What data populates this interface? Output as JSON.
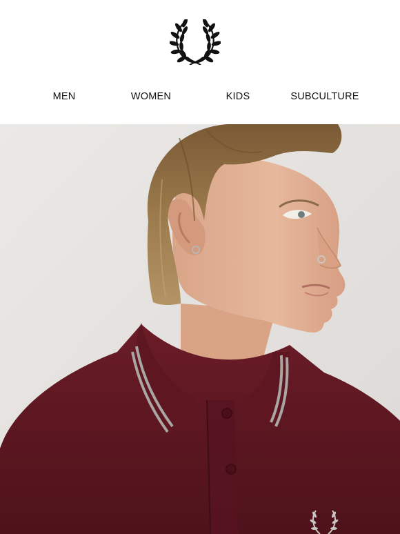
{
  "brand": {
    "logo_icon": "laurel-wreath-icon",
    "logo_color": "#111111"
  },
  "nav": {
    "items": [
      {
        "label": "MEN"
      },
      {
        "label": "WOMEN"
      },
      {
        "label": "KIDS"
      },
      {
        "label": "SUBCULTURE"
      }
    ]
  },
  "hero": {
    "image": "model-in-burgundy-twin-tipped-polo-shirt",
    "shirt_color": "#5a1520",
    "tipping_color": "#a9a6a3",
    "background_color": "#e8e6e4"
  }
}
